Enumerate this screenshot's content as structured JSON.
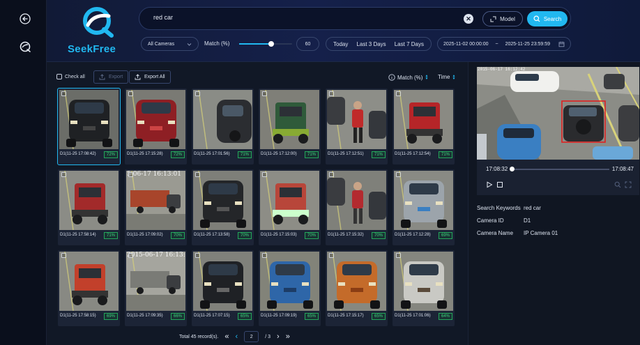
{
  "header": {
    "brand": "SeekFree",
    "search": {
      "value": "red car",
      "placeholder": ""
    },
    "model_label": "Model",
    "search_label": "Search",
    "camera_select": "All Cameras",
    "match_label": "Match (%)",
    "match_value": "60",
    "match_fraction": 0.6,
    "date_presets": [
      "Today",
      "Last 3 Days",
      "Last 7 Days"
    ],
    "date_start": "2025-11-02 00:00:00",
    "date_sep": "~",
    "date_end": "2025-11-25 23:59:59"
  },
  "toolbar": {
    "check_all": "Check all",
    "export": "Export",
    "export_all": "Export All",
    "sort_match": "Match (%)",
    "sort_time": "Time"
  },
  "results": [
    {
      "caption": "D1(11-25 17:08:42)",
      "match": "72%",
      "scene": "black-suv",
      "selected": true
    },
    {
      "caption": "D1(11-25 17:15:28)",
      "match": "72%",
      "scene": "red-hatch"
    },
    {
      "caption": "D1(11-25 17:01:56)",
      "match": "71%",
      "scene": "dark-sedan-side"
    },
    {
      "caption": "D1(11-25 17:12:00)",
      "match": "71%",
      "scene": "green-trike"
    },
    {
      "caption": "D1(11-25 17:12:51)",
      "match": "71%",
      "scene": "pedestrian-red"
    },
    {
      "caption": "D1(11-25 17:12:54)",
      "match": "71%",
      "scene": "red-trike-top"
    },
    {
      "caption": "D1(11-25 17:58:14)",
      "match": "71%",
      "scene": "red-trike-back",
      "overlay": ""
    },
    {
      "caption": "D1(11-25 17:09:02)",
      "match": "70%",
      "scene": "truck-road",
      "overlay": "5-06-17 16:13:01"
    },
    {
      "caption": "D1(11-25 17:13:58)",
      "match": "70%",
      "scene": "black-sedan"
    },
    {
      "caption": "D1(11-25 17:15:03)",
      "match": "70%",
      "scene": "covered-trike"
    },
    {
      "caption": "D1(11-25 17:15:32)",
      "match": "70%",
      "scene": "motorbike-red"
    },
    {
      "caption": "D1(11-25 17:12:28)",
      "match": "69%",
      "scene": "silver-car"
    },
    {
      "caption": "D1(11-25 17:58:15)",
      "match": "69%",
      "scene": "red-cabin-trike"
    },
    {
      "caption": "D1(11-25 17:09:35)",
      "match": "66%",
      "scene": "road-sign",
      "overlay": "2015-06-17 16:13:2"
    },
    {
      "caption": "D1(11-25 17:07:15)",
      "match": "65%",
      "scene": "black-sedan-2"
    },
    {
      "caption": "D1(11-25 17:09:19)",
      "match": "65%",
      "scene": "blue-hatch"
    },
    {
      "caption": "D1(11-25 17:15:17)",
      "match": "65%",
      "scene": "orange-hatch"
    },
    {
      "caption": "D1(11-25 17:01:06)",
      "match": "64%",
      "scene": "silver-hatch"
    }
  ],
  "pagination": {
    "total": "Total 45 record(s).",
    "current": "2",
    "of": "/ 3"
  },
  "preview": {
    "overlay_time": "2015-06-17 16:12:42",
    "time_current": "17:08:32",
    "time_end": "17:08:47",
    "progress": 0.0
  },
  "details": [
    {
      "key": "Search Keywords",
      "value": "red car"
    },
    {
      "key": "Camera ID",
      "value": "D1"
    },
    {
      "key": "Camera Name",
      "value": "IP Camera 01"
    }
  ],
  "colors": {
    "accent": "#21b8f0",
    "match_badge": "#3fd27f",
    "highlight_box": "#e02020"
  }
}
